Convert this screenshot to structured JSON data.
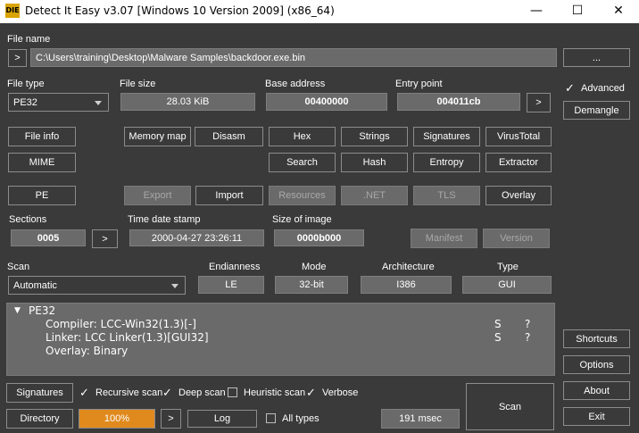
{
  "window": {
    "title": "Detect It Easy v3.07 [Windows 10 Version 2009] (x86_64)",
    "icon_text": "DIE",
    "minimize": "—",
    "maximize": "☐",
    "close": "✕"
  },
  "file_name": {
    "label": "File name",
    "open_button": ">",
    "value": "C:\\Users\\training\\Desktop\\Malware Samples\\backdoor.exe.bin",
    "browse_button": "..."
  },
  "info": {
    "file_type_label": "File type",
    "file_type_value": "PE32",
    "file_size_label": "File size",
    "file_size_value": "28.03 KiB",
    "base_address_label": "Base address",
    "base_address_value": "00400000",
    "entry_point_label": "Entry point",
    "entry_point_value": "004011cb",
    "entry_point_button": ">"
  },
  "right": {
    "advanced_label": "Advanced",
    "demangle": "Demangle",
    "shortcuts": "Shortcuts",
    "options": "Options",
    "about": "About",
    "exit": "Exit"
  },
  "tools": {
    "file_info": "File info",
    "memory_map": "Memory map",
    "disasm": "Disasm",
    "hex": "Hex",
    "strings": "Strings",
    "signatures": "Signatures",
    "virustotal": "VirusTotal",
    "mime": "MIME",
    "search": "Search",
    "hash": "Hash",
    "entropy": "Entropy",
    "extractor": "Extractor"
  },
  "pe": {
    "pe": "PE",
    "export": "Export",
    "import": "Import",
    "resources": "Resources",
    "net": ".NET",
    "tls": "TLS",
    "overlay": "Overlay",
    "sections_label": "Sections",
    "sections_value": "0005",
    "sections_button": ">",
    "time_date_stamp_label": "Time date stamp",
    "time_date_stamp_value": "2000-04-27 23:26:11",
    "size_of_image_label": "Size of image",
    "size_of_image_value": "0000b000",
    "manifest": "Manifest",
    "version": "Version"
  },
  "scan": {
    "scan_label": "Scan",
    "scan_value": "Automatic",
    "endianness_label": "Endianness",
    "endianness_value": "LE",
    "mode_label": "Mode",
    "mode_value": "32-bit",
    "architecture_label": "Architecture",
    "architecture_value": "I386",
    "type_label": "Type",
    "type_value": "GUI"
  },
  "results": {
    "root": "PE32",
    "rows": [
      {
        "text": "Compiler: LCC-Win32(1.3)[-]",
        "s": "S",
        "q": "?"
      },
      {
        "text": "Linker: LCC Linker(1.3)[GUI32]",
        "s": "S",
        "q": "?"
      },
      {
        "text": "Overlay: Binary",
        "s": "",
        "q": ""
      }
    ]
  },
  "bottom": {
    "signatures": "Signatures",
    "recursive_scan": "Recursive scan",
    "deep_scan": "Deep scan",
    "heuristic_scan": "Heuristic scan",
    "verbose": "Verbose",
    "directory": "Directory",
    "progress": "100%",
    "progress_fraction": 1.0,
    "progress_button": ">",
    "log": "Log",
    "all_types": "All types",
    "time": "191 msec",
    "scan": "Scan",
    "progress_color": "#e08a1e"
  }
}
